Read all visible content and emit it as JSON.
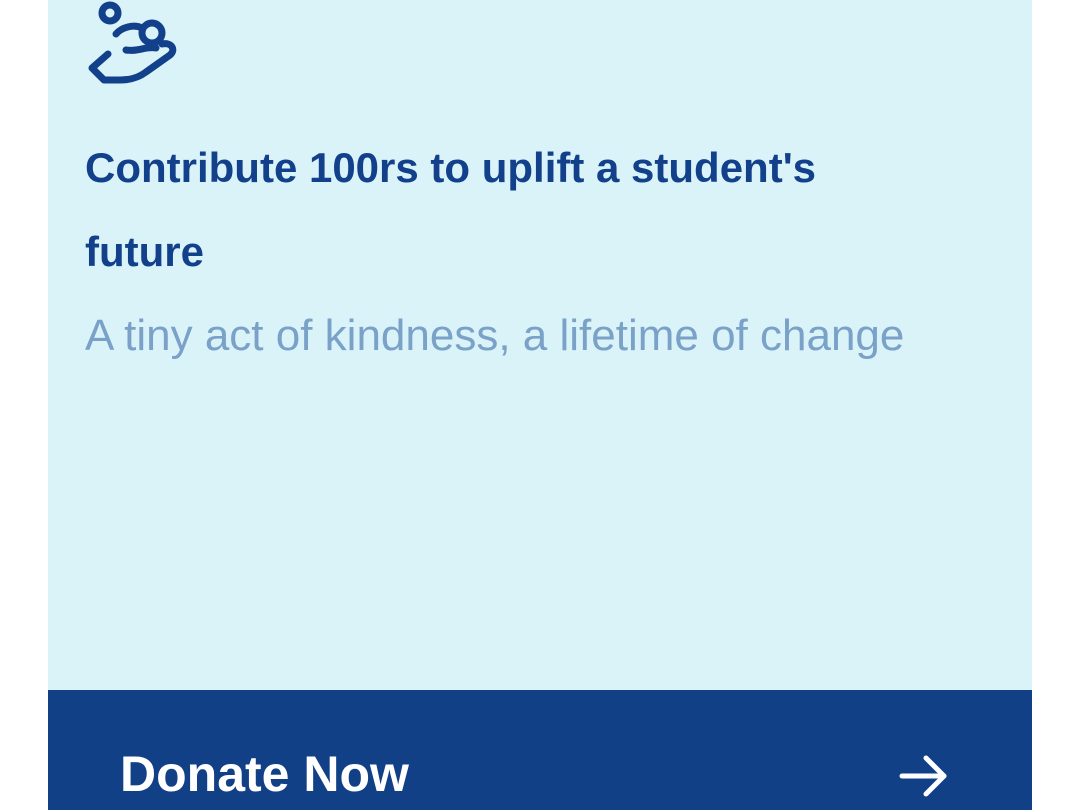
{
  "card": {
    "icon": "hand-holding-coin-icon",
    "headline": "Contribute 100rs to uplift a student's future",
    "subtitle": "A tiny act of kindness, a lifetime of change"
  },
  "donate": {
    "label": "Donate Now",
    "icon": "arrow-right-icon"
  },
  "colors": {
    "card_background": "#daf3f9",
    "primary": "#124087",
    "subtitle": "#7aa1c8",
    "button_text": "#ffffff"
  }
}
